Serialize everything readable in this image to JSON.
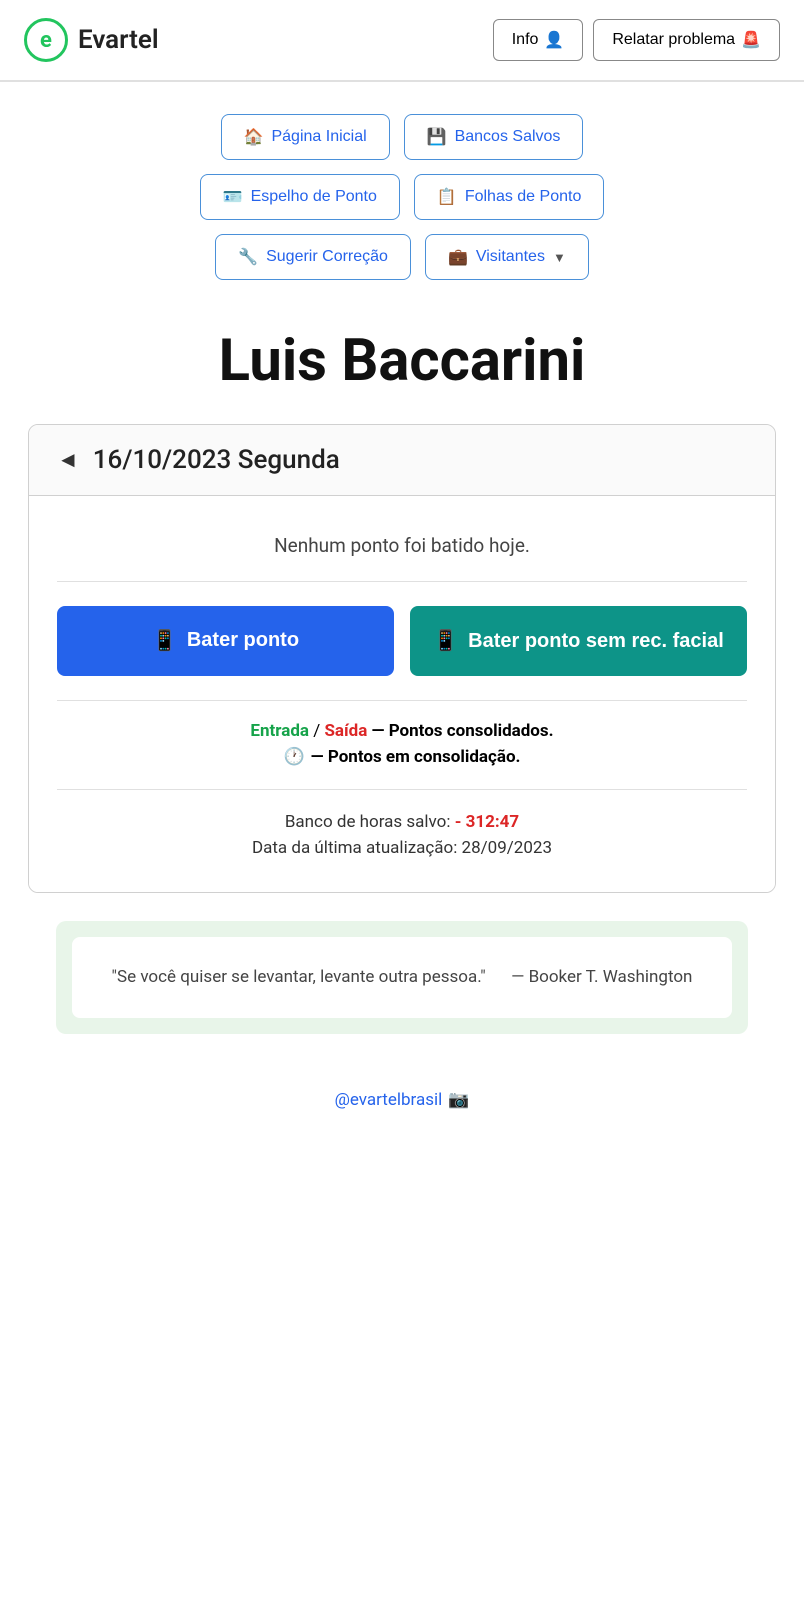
{
  "header": {
    "logo_letter": "e",
    "app_name": "Evartel",
    "info_label": "Info",
    "info_icon": "👤",
    "report_label": "Relatar problema",
    "report_icon": "🚨"
  },
  "nav": {
    "row1": [
      {
        "id": "pagina-inicial",
        "icon": "🏠",
        "label": "Página Inicial"
      },
      {
        "id": "bancos-salvos",
        "icon": "💾",
        "label": "Bancos Salvos"
      }
    ],
    "row2": [
      {
        "id": "espelho-ponto",
        "icon": "🪪",
        "label": "Espelho de Ponto"
      },
      {
        "id": "folhas-ponto",
        "icon": "📋",
        "label": "Folhas de Ponto"
      }
    ],
    "row3": [
      {
        "id": "sugerir-correcao",
        "icon": "🔧",
        "label": "Sugerir Correção"
      },
      {
        "id": "visitantes",
        "icon": "💼",
        "label": "Visitantes",
        "has_dropdown": true
      }
    ]
  },
  "user": {
    "name": "Luis Baccarini"
  },
  "date_card": {
    "back_arrow": "◄",
    "date": "16/10/2023 Segunda",
    "no_point_message": "Nenhum ponto foi batido hoje.",
    "btn_bater_icon": "📱",
    "btn_bater_label": "Bater ponto",
    "btn_bater_sem_icon": "📱",
    "btn_bater_sem_label": "Bater ponto sem rec. facial",
    "legend_entrada": "Entrada",
    "legend_separator": " / ",
    "legend_saida": "Saída",
    "legend_consolidated": "— Pontos consolidados.",
    "legend_clock_icon": "🕐",
    "legend_consolidating": "— Pontos em consolidação.",
    "banco_label": "Banco de horas salvo: ",
    "banco_value": "- 312:47",
    "update_label": "Data da última atualização: 28/09/2023"
  },
  "quote": {
    "text": "\"Se você quiser se levantar, levante outra pessoa.\"",
    "author": "— Booker T. Washington"
  },
  "footer": {
    "instagram_label": "@evartelbrasil",
    "instagram_icon": "📷"
  }
}
